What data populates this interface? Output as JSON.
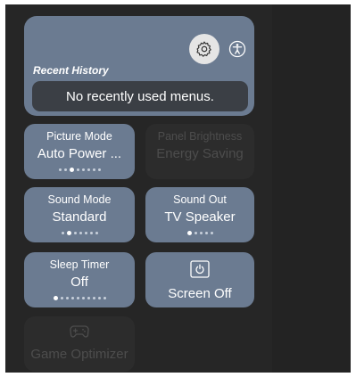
{
  "recent_history": {
    "title": "Recent History",
    "empty_message": "No recently used menus."
  },
  "icons": {
    "settings": "gear-icon",
    "accessibility": "accessibility-icon",
    "power": "power-icon",
    "gamepad": "gamepad-icon"
  },
  "cards": {
    "picture_mode": {
      "label": "Picture Mode",
      "value": "Auto Power ..."
    },
    "panel_brightness": {
      "label": "Panel Brightness",
      "value": "Energy Saving"
    },
    "sound_mode": {
      "label": "Sound Mode",
      "value": "Standard"
    },
    "sound_out": {
      "label": "Sound Out",
      "value": "TV Speaker"
    },
    "sleep_timer": {
      "label": "Sleep Timer",
      "value": "Off"
    },
    "screen_off": {
      "label": "Screen Off"
    },
    "game_optimizer": {
      "label": "Game Optimizer"
    }
  },
  "colors": {
    "card_active": "#6b7b91",
    "card_disabled": "#2c2c2c",
    "background": "#232323"
  }
}
